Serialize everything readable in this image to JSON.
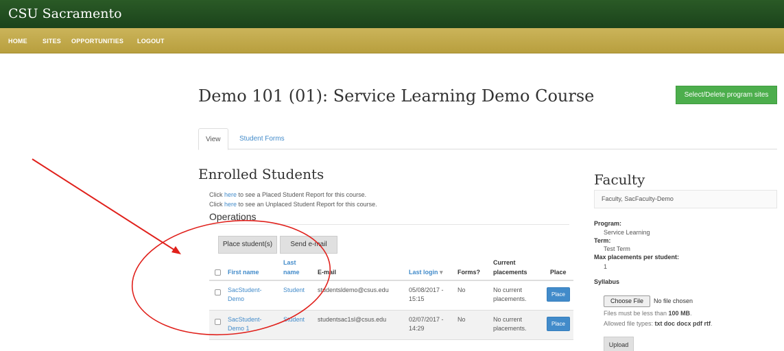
{
  "header": {
    "site_name": "CSU Sacramento"
  },
  "nav": {
    "items": [
      "HOME",
      "SITES",
      "OPPORTUNITIES",
      "LOGOUT"
    ]
  },
  "page": {
    "title": "Demo 101 (01): Service Learning Demo Course",
    "select_button": "Select/Delete program sites"
  },
  "tabs": [
    "View",
    "Student Forms"
  ],
  "enrolled": {
    "title": "Enrolled Students",
    "line1_pre": "Click ",
    "line1_link": "here",
    "line1_post": " to see a Placed Student Report for this course.",
    "line2_pre": "Click ",
    "line2_link": "here",
    "line2_post": " to see an Unplaced Student Report for this course.",
    "operations": "Operations",
    "place_students_button": "Place student(s)",
    "send_email_button": "Send e-mail",
    "columns": {
      "first_name": "First name",
      "last_name_1": "Last",
      "last_name_2": "name",
      "email": "E-mail",
      "last_login": "Last login",
      "forms": "Forms?",
      "current_1": "Current",
      "current_2": "placements",
      "place": "Place"
    },
    "rows": [
      {
        "first_1": "SacStudent-",
        "first_2": "Demo",
        "last": "Student",
        "email": "studentsldemo@csus.edu",
        "login_1": "05/08/2017 -",
        "login_2": "15:15",
        "forms": "No",
        "place_1": "No current",
        "place_2": "placements.",
        "button": "Place"
      },
      {
        "first_1": "SacStudent-",
        "first_2": "Demo 1",
        "last": "Student",
        "email": "studentsac1sl@csus.edu",
        "login_1": "02/07/2017 -",
        "login_2": "14:29",
        "forms": "No",
        "place_1": "No current",
        "place_2": "placements.",
        "button": "Place"
      }
    ]
  },
  "faculty": {
    "title": "Faculty",
    "name": "Faculty, SacFaculty-Demo",
    "program_label": "Program:",
    "program_value": "Service Learning",
    "term_label": "Term:",
    "term_value": "Test Term",
    "max_label": "Max placements per student:",
    "max_value": "1",
    "syllabus_label": "Syllabus",
    "choose_file": "Choose File",
    "no_file": "No file chosen",
    "size_pre": "Files must be less than ",
    "size_value": "100 MB",
    "size_post": ".",
    "types_pre": "Allowed file types: ",
    "types_value": "txt doc docx pdf rtf",
    "types_post": ".",
    "upload": "Upload"
  },
  "colors": {
    "topbar": "#1f4d20",
    "navbar": "#c2aa4c",
    "link": "#428bca",
    "green_button": "#4cae4c",
    "annotation": "#e0201b"
  },
  "icons": [
    "sort-arrow-icon",
    "annotation-arrow-icon"
  ]
}
